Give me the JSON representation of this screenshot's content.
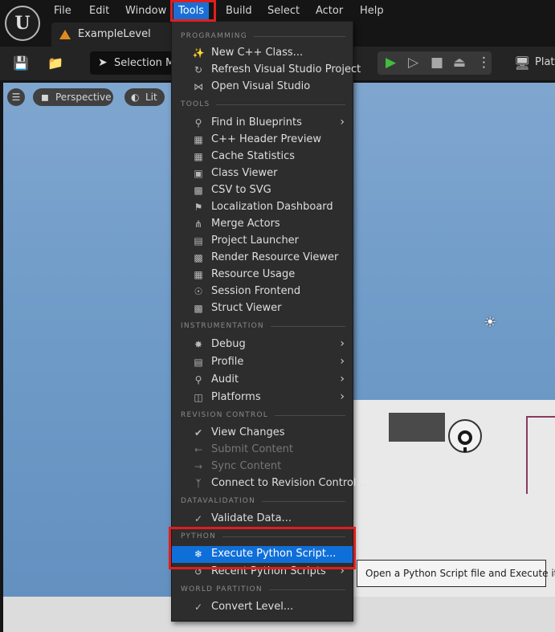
{
  "menubar": {
    "items": [
      {
        "label": "File"
      },
      {
        "label": "Edit"
      },
      {
        "label": "Window"
      },
      {
        "label": "Tools"
      },
      {
        "label": "Build"
      },
      {
        "label": "Select"
      },
      {
        "label": "Actor"
      },
      {
        "label": "Help"
      }
    ],
    "active": "Tools"
  },
  "tab": {
    "label": "ExampleLevel"
  },
  "toolbar": {
    "selection_mode_label": "Selection Mode",
    "platforms_label": "Platf"
  },
  "viewport": {
    "perspective_label": "Perspective",
    "lit_label": "Lit"
  },
  "menu": {
    "sections": {
      "programming": "PROGRAMMING",
      "tools": "TOOLS",
      "instrumentation": "INSTRUMENTATION",
      "revision_control": "REVISION CONTROL",
      "datavalidation": "DATAVALIDATION",
      "python": "PYTHON",
      "world_partition": "WORLD PARTITION"
    },
    "programming": [
      "New C++ Class...",
      "Refresh Visual Studio Project",
      "Open Visual Studio"
    ],
    "tools": [
      "Find in Blueprints",
      "C++ Header Preview",
      "Cache Statistics",
      "Class Viewer",
      "CSV to SVG",
      "Localization Dashboard",
      "Merge Actors",
      "Project Launcher",
      "Render Resource Viewer",
      "Resource Usage",
      "Session Frontend",
      "Struct Viewer"
    ],
    "instrumentation": [
      "Debug",
      "Profile",
      "Audit",
      "Platforms"
    ],
    "revision_control": [
      "View Changes",
      "Submit Content",
      "Sync Content",
      "Connect to Revision Control..."
    ],
    "datavalidation": [
      "Validate Data..."
    ],
    "python": [
      "Execute Python Script...",
      "Recent Python Scripts"
    ],
    "world_partition": [
      "Convert Level..."
    ]
  },
  "tooltip": {
    "text": "Open a Python Script file and Execute it."
  },
  "colors": {
    "highlight": "#0f6fd9",
    "annotation": "#e01e1e",
    "menu_bg": "#2d2d2d"
  }
}
